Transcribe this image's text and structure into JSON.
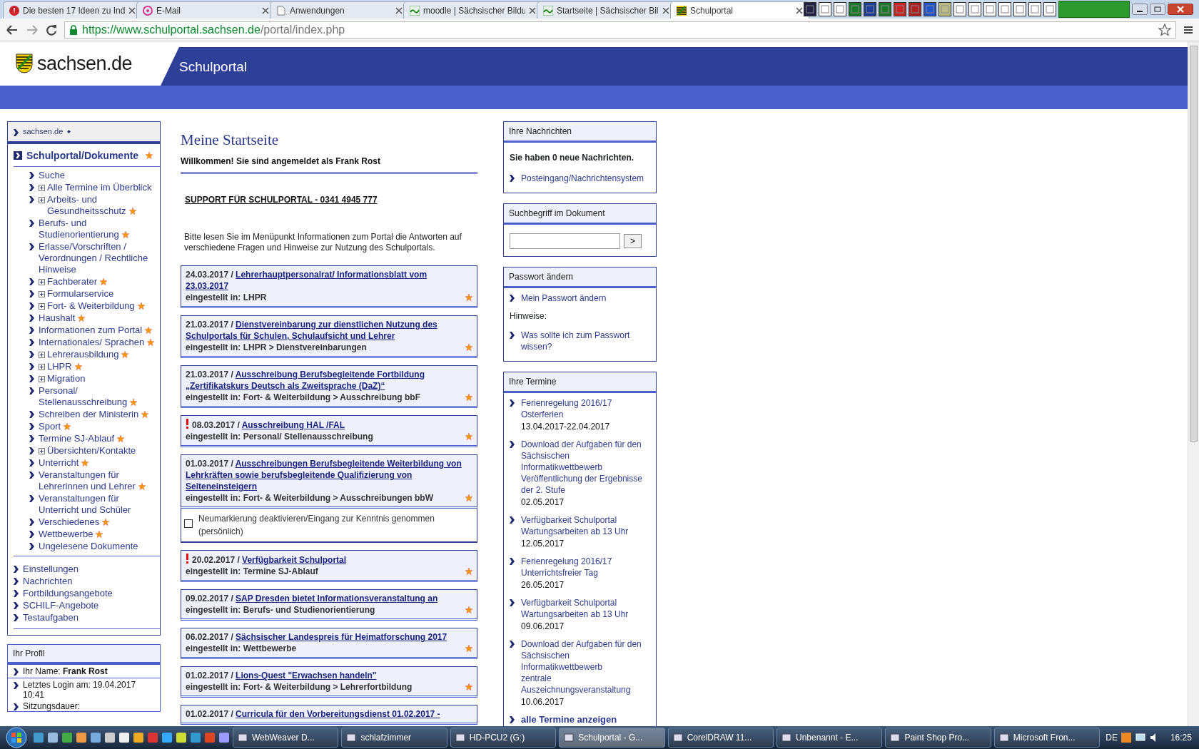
{
  "browser": {
    "tabs": [
      {
        "title": "Die besten 17 Ideen zu Ind",
        "selected": false
      },
      {
        "title": "E-Mail",
        "selected": false
      },
      {
        "title": "Anwendungen",
        "selected": false
      },
      {
        "title": "moodle | Sächsischer Bildu",
        "selected": false
      },
      {
        "title": "Startseite | Sächsischer Bil",
        "selected": false
      },
      {
        "title": "Schulportal",
        "selected": true
      }
    ],
    "url_host": "https://www.schulportal.sachsen.de",
    "url_path": "/portal/index.php"
  },
  "header": {
    "logo": "sachsen.de",
    "title": "Schulportal"
  },
  "sidebar": {
    "top_link": "sachsen.de",
    "section": {
      "title": "Schulportal/Dokumente",
      "new": true
    },
    "items": [
      {
        "label": "Suche",
        "expandable": false,
        "new": false
      },
      {
        "label": "Alle Termine im Überblick",
        "expandable": true,
        "new": false
      },
      {
        "label": "Arbeits- und Gesundheitsschutz",
        "expandable": true,
        "new": true
      },
      {
        "label": "Berufs- und Studienorientierung",
        "expandable": false,
        "new": true
      },
      {
        "label": "Erlasse/Vorschriften / Verordnungen / Rechtliche Hinweise",
        "expandable": false,
        "new": false
      },
      {
        "label": "Fachberater",
        "expandable": true,
        "new": true
      },
      {
        "label": "Formularservice",
        "expandable": true,
        "new": false
      },
      {
        "label": "Fort- & Weiterbildung",
        "expandable": true,
        "new": true
      },
      {
        "label": "Haushalt",
        "expandable": false,
        "new": true
      },
      {
        "label": "Informationen zum Portal",
        "expandable": false,
        "new": true
      },
      {
        "label": "Internationales/ Sprachen",
        "expandable": false,
        "new": true
      },
      {
        "label": "Lehrerausbildung",
        "expandable": true,
        "new": true
      },
      {
        "label": "LHPR",
        "expandable": true,
        "new": true
      },
      {
        "label": "Migration",
        "expandable": true,
        "new": false
      },
      {
        "label": "Personal/ Stellenausschreibung",
        "expandable": false,
        "new": true
      },
      {
        "label": "Schreiben der Ministerin",
        "expandable": false,
        "new": true
      },
      {
        "label": "Sport",
        "expandable": false,
        "new": true
      },
      {
        "label": "Termine SJ-Ablauf",
        "expandable": false,
        "new": true
      },
      {
        "label": "Übersichten/Kontakte",
        "expandable": true,
        "new": false
      },
      {
        "label": "Unterricht",
        "expandable": false,
        "new": true
      },
      {
        "label": "Veranstaltungen für Lehrerinnen und Lehrer",
        "expandable": false,
        "new": true
      },
      {
        "label": "Veranstaltungen für Unterricht und Schüler",
        "expandable": false,
        "new": false
      },
      {
        "label": "Verschiedenes",
        "expandable": false,
        "new": true
      },
      {
        "label": "Wettbewerbe",
        "expandable": false,
        "new": true
      },
      {
        "label": "Ungelesene Dokumente",
        "expandable": false,
        "new": false
      }
    ],
    "other_items": [
      "Einstellungen",
      "Nachrichten",
      "Fortbildungsangebote",
      "SCHILF-Angebote",
      "Testaufgaben"
    ]
  },
  "profile": {
    "title": "Ihr Profil",
    "name_label": "Ihr Name:",
    "name": "Frank Rost",
    "login_label": "Letztes Login am:",
    "login": "19.04.2017 10:41",
    "session_label": "Sitzungsdauer:"
  },
  "main": {
    "heading": "Meine Startseite",
    "welcome": "Willkommen! Sie sind angemeldet als Frank Rost",
    "support": "SUPPORT FÜR SCHULPORTAL - 0341 4945 777",
    "info_before": "Bitte lesen Sie im Menüpunkt",
    "info_link": "Informationen zum Portal",
    "info_after": "die Antworten auf verschiedene Fragen und Hinweise zur Nutzung des Schulportals.",
    "news": [
      {
        "date": "24.03.2017 /",
        "title_lines": [
          "Lehrerhauptpersonalrat/ Informationsblatt vom",
          "23.03.2017"
        ],
        "category": "eingestellt in: LHPR",
        "important": false,
        "new": true
      },
      {
        "date": "21.03.2017 /",
        "title_lines": [
          "Dienstvereinbarung zur dienstlichen Nutzung des",
          "Schulportals für Schulen, Schulaufsicht und Lehrer"
        ],
        "category": "eingestellt in: LHPR > Dienstvereinbarungen",
        "important": false,
        "new": true
      },
      {
        "date": "21.03.2017 /",
        "title_lines": [
          "Ausschreibung Berufsbegleitende Fortbildung",
          "„Zertifikatskurs Deutsch als Zweitsprache (DaZ)“"
        ],
        "category": "eingestellt in: Fort- & Weiterbildung > Ausschreibung bbF",
        "important": false,
        "new": true
      },
      {
        "date": "08.03.2017 /",
        "title_lines": [
          "Ausschreibung HAL /FAL"
        ],
        "category": "eingestellt in: Personal/ Stellenausschreibung",
        "important": true,
        "new": true
      },
      {
        "date": "01.03.2017 /",
        "title_lines": [
          "Ausschreibungen Berufsbegleitende Weiterbildung von",
          "Lehrkräften sowie berufsbegleitende Qualifizierung von",
          "Seiteneinsteigern"
        ],
        "category": "eingestellt in: Fort- & Weiterbildung > Ausschreibungen bbW",
        "important": false,
        "new": true,
        "acknowledge": {
          "label": "Neumarkierung deaktivieren/Eingang zur Kenntnis genommen (persönlich)",
          "checked": false
        }
      },
      {
        "date": "20.02.2017 /",
        "title_lines": [
          "Verfügbarkeit Schulportal"
        ],
        "category": "eingestellt in: Termine SJ-Ablauf",
        "important": true,
        "new": true
      },
      {
        "date": "09.02.2017 /",
        "title_lines": [
          "SAP Dresden bietet Informationsveranstaltung an"
        ],
        "category": "eingestellt in: Berufs- und Studienorientierung",
        "important": false,
        "new": true
      },
      {
        "date": "06.02.2017 /",
        "title_lines": [
          "Sächsischer Landespreis für Heimatforschung 2017"
        ],
        "category": "eingestellt in: Wettbewerbe",
        "important": false,
        "new": true
      },
      {
        "date": "01.02.2017 /",
        "title_lines": [
          "Lions-Quest \"Erwachsen handeln\""
        ],
        "category": "eingestellt in: Fort- & Weiterbildung > Lehrerfortbildung",
        "important": false,
        "new": true
      },
      {
        "date": "01.02.2017 /",
        "title_lines": [
          "Curricula für den Vorbereitungsdienst 01.02.2017 -"
        ]
      }
    ]
  },
  "messages": {
    "title": "Ihre Nachrichten",
    "text": "Sie haben 0 neue Nachrichten.",
    "link": "Posteingang/Nachrichtensystem"
  },
  "search": {
    "title": "Suchbegriff im Dokument",
    "button": ">"
  },
  "password": {
    "title": "Passwort ändern",
    "link": "Mein Passwort ändern",
    "hint_label": "Hinweise:",
    "hint_link": "Was sollte ich zum Passwort wissen?"
  },
  "dates": {
    "title": "Ihre Termine",
    "items": [
      {
        "lines": [
          "Ferienregelung 2016/17",
          "Osterferien"
        ],
        "date": "13.04.2017-22.04.2017"
      },
      {
        "lines": [
          "Download der Aufgaben für den",
          "Sächsischen",
          "Informatikwettbewerb",
          "Veröffentlichung der Ergebnisse",
          "der 2. Stufe"
        ],
        "date": "02.05.2017"
      },
      {
        "lines": [
          "Verfügbarkeit Schulportal",
          "Wartungsarbeiten ab 13 Uhr"
        ],
        "date": "12.05.2017"
      },
      {
        "lines": [
          "Ferienregelung 2016/17",
          "Unterrichtsfreier Tag"
        ],
        "date": "26.05.2017"
      },
      {
        "lines": [
          "Verfügbarkeit Schulportal",
          "Wartungsarbeiten ab 13 Uhr"
        ],
        "date": "09.06.2017"
      },
      {
        "lines": [
          "Download der Aufgaben für den",
          "Sächsischen",
          "Informatikwettbewerb",
          "zentrale",
          "Auszeichnungsveranstaltung"
        ],
        "date": "10.06.2017"
      }
    ],
    "more": "alle Termine anzeigen"
  },
  "taskbar": {
    "windows": [
      {
        "label": "WebWeaver D...",
        "selected": false
      },
      {
        "label": "schlafzimmer",
        "selected": false
      },
      {
        "label": "HD-PCU2 (G:)",
        "selected": false
      },
      {
        "label": "Schulportal - G...",
        "selected": true
      },
      {
        "label": "CorelDRAW 11...",
        "selected": false
      },
      {
        "label": "Unbenannt - E...",
        "selected": false
      },
      {
        "label": "Paint Shop Pro...",
        "selected": false
      },
      {
        "label": "Microsoft Fron...",
        "selected": false
      }
    ],
    "language": "DE",
    "time": "16:25"
  }
}
